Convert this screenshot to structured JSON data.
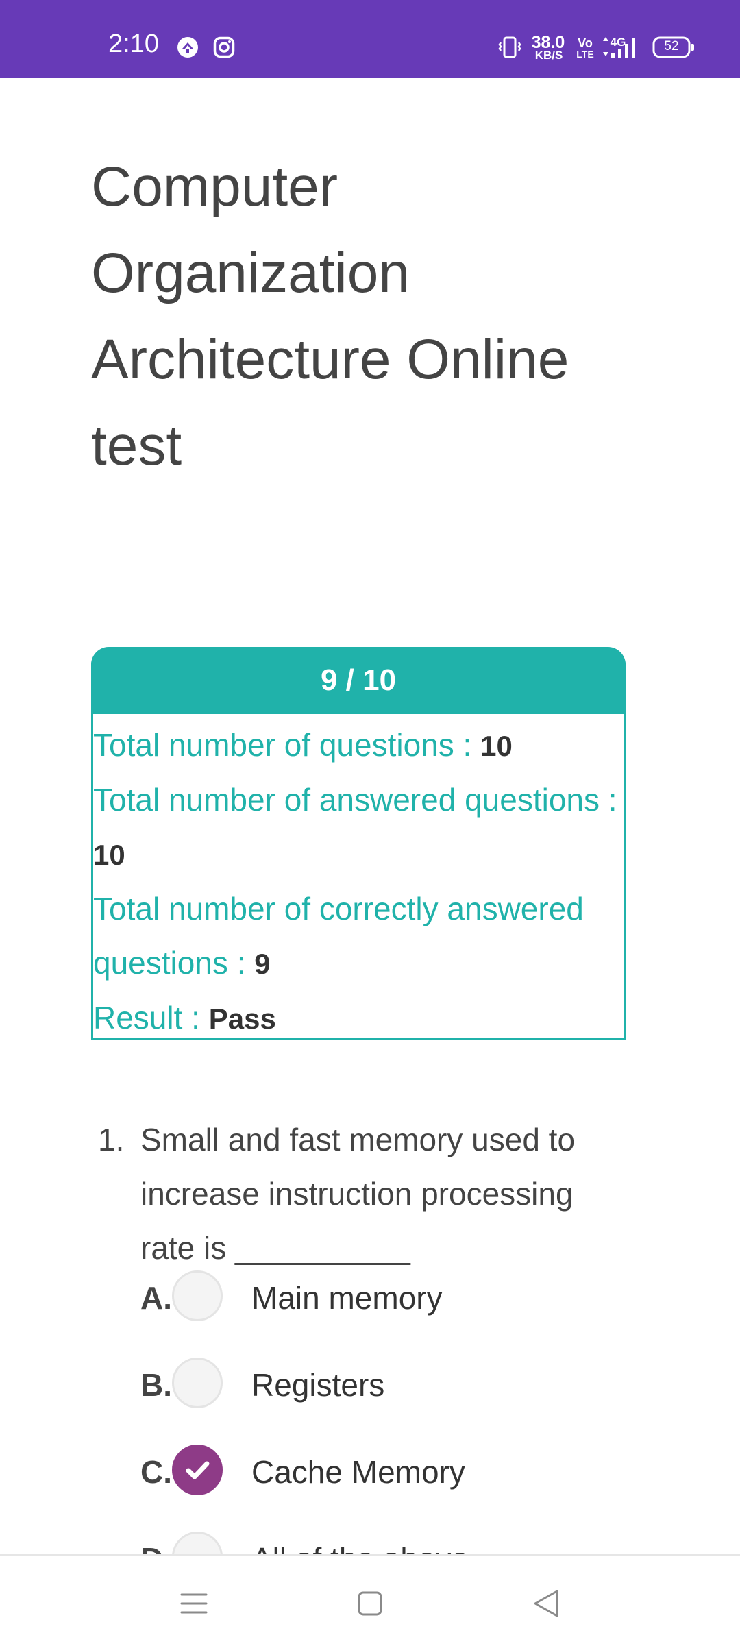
{
  "status_bar": {
    "time": "2:10",
    "net_speed_value": "38.0",
    "net_speed_unit": "KB/S",
    "volte_top": "Vo",
    "volte_bottom": "LTE",
    "network_type": "4G",
    "battery_level": "52",
    "icons": [
      "vpn-icon",
      "instagram-icon",
      "vibrate-icon",
      "volte-icon",
      "signal-icon",
      "battery-icon"
    ],
    "background_color": "#673ab7"
  },
  "page": {
    "title": "Computer Organization Architecture Online test"
  },
  "score_card": {
    "score": "9 / 10",
    "accent_color": "#20b2aa",
    "rows": [
      {
        "label": "Total number of questions : ",
        "value": "10"
      },
      {
        "label": "Total number of answered questions : ",
        "value": "10"
      },
      {
        "label": "Total number of correctly answered questions : ",
        "value": "9"
      },
      {
        "label": "Result : ",
        "value": "Pass"
      }
    ]
  },
  "question": {
    "number": "1.",
    "text": "Small and fast memory used to increase instruction processing rate is __________",
    "selected_color": "#8e3b87",
    "options": [
      {
        "letter": "A.",
        "label": "Main memory",
        "selected": false
      },
      {
        "letter": "B.",
        "label": "Registers",
        "selected": false
      },
      {
        "letter": "C.",
        "label": "Cache Memory",
        "selected": true
      },
      {
        "letter": "D.",
        "label": "All of the above",
        "selected": false
      }
    ]
  },
  "nav_bar": {
    "icons": [
      "menu-icon",
      "home-icon",
      "back-icon"
    ]
  }
}
